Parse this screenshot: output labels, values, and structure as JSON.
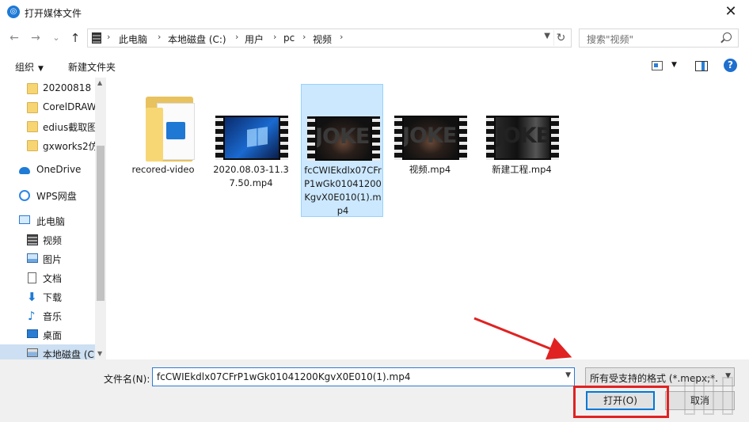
{
  "window": {
    "title": "打开媒体文件",
    "close_glyph": "✕"
  },
  "nav": {
    "back": "←",
    "forward": "→",
    "recent": "⌄",
    "up": "↑",
    "breadcrumbs": [
      "此电脑",
      "本地磁盘 (C:)",
      "用户",
      "pc",
      "视频"
    ],
    "separator": "›",
    "search_placeholder": "搜索\"视频\""
  },
  "toolbar": {
    "organize_label": "组织",
    "new_folder_label": "新建文件夹",
    "help_label": "?"
  },
  "sidebar": {
    "items": [
      {
        "label": "20200818",
        "icon": "folder-icon"
      },
      {
        "label": "CorelDRAW",
        "icon": "folder-icon"
      },
      {
        "label": "edius截取图",
        "icon": "folder-icon"
      },
      {
        "label": "gxworks2仿",
        "icon": "folder-icon"
      },
      {
        "label": "OneDrive",
        "icon": "onedrive-icon"
      },
      {
        "label": "WPS网盘",
        "icon": "wps-cloud-icon"
      },
      {
        "label": "此电脑",
        "icon": "this-pc-icon"
      },
      {
        "label": "视频",
        "icon": "video-folder-icon"
      },
      {
        "label": "图片",
        "icon": "pictures-icon"
      },
      {
        "label": "文档",
        "icon": "documents-icon"
      },
      {
        "label": "下载",
        "icon": "downloads-icon"
      },
      {
        "label": "音乐",
        "icon": "music-icon"
      },
      {
        "label": "桌面",
        "icon": "desktop-icon"
      },
      {
        "label": "本地磁盘 (C",
        "icon": "drive-icon"
      }
    ]
  },
  "files": [
    {
      "name": "recored-video",
      "kind": "folder"
    },
    {
      "name": "2020.08.03-11.37.50.mp4",
      "kind": "video"
    },
    {
      "name": "fcCWIEkdlx07CFrP1wGk01041200KgvX0E010(1).mp4",
      "kind": "video"
    },
    {
      "name": "视频.mp4",
      "kind": "video"
    },
    {
      "name": "新建工程.mp4",
      "kind": "video"
    }
  ],
  "thumb_text": {
    "joker": "JOKER",
    "dark": "JOKE"
  },
  "footer": {
    "filename_label": "文件名(N):",
    "filename_value": "fcCWIEkdlx07CFrP1wGk01041200KgvX0E010(1).mp4",
    "filter_value": "所有受支持的格式 (*.mepx;*.",
    "open_label": "打开(O)",
    "cancel_label": "取消"
  },
  "colors": {
    "accent": "#0078d7",
    "selection": "#cce8ff",
    "annotation": "#e02222"
  }
}
